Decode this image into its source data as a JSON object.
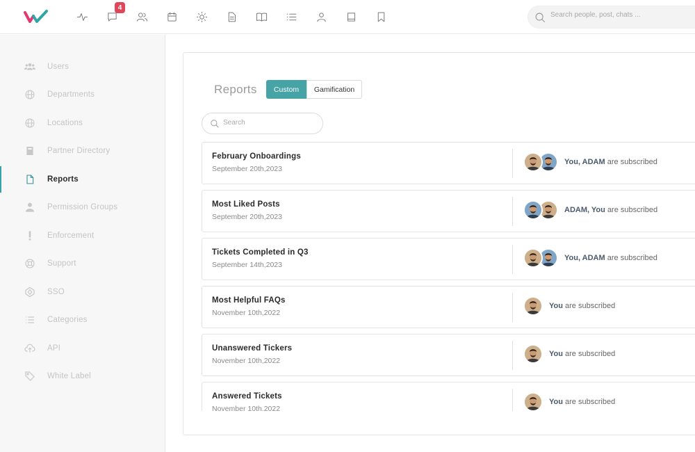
{
  "topbar": {
    "badge_count": "4",
    "search_placeholder": "Search people, post, chats ..."
  },
  "sidebar": {
    "items": [
      {
        "label": "Users",
        "icon": "users-icon"
      },
      {
        "label": "Departments",
        "icon": "globe-icon"
      },
      {
        "label": "Locations",
        "icon": "globe-icon"
      },
      {
        "label": "Partner Directory",
        "icon": "book-icon"
      },
      {
        "label": "Reports",
        "icon": "document-icon",
        "active": true
      },
      {
        "label": "Permission Groups",
        "icon": "person-icon"
      },
      {
        "label": "Enforcement",
        "icon": "exclamation-icon"
      },
      {
        "label": "Support",
        "icon": "lifebuoy-icon"
      },
      {
        "label": "SSO",
        "icon": "sso-icon"
      },
      {
        "label": "Categories",
        "icon": "list-icon"
      },
      {
        "label": "API",
        "icon": "cloud-upload-icon"
      },
      {
        "label": "White Label",
        "icon": "tag-icon"
      }
    ]
  },
  "main": {
    "title": "Reports",
    "tabs": [
      {
        "label": "Custom",
        "active": true
      },
      {
        "label": "Gamification",
        "active": false
      }
    ],
    "search_placeholder": "Search",
    "reports": [
      {
        "name": "February Onboardings",
        "date": "September 20th,2023",
        "subscribers": "You, ADAM",
        "suffix": "are subscribed",
        "avatars": [
          "you",
          "adam"
        ]
      },
      {
        "name": "Most Liked Posts",
        "date": "September 20th,2023",
        "subscribers": "ADAM, You",
        "suffix": "are subscribed",
        "avatars": [
          "adam",
          "you"
        ]
      },
      {
        "name": "Tickets Completed in Q3",
        "date": "September 14th,2023",
        "subscribers": "You, ADAM",
        "suffix": "are subscribed",
        "avatars": [
          "you",
          "adam"
        ]
      },
      {
        "name": "Most Helpful FAQs",
        "date": "November 10th,2022",
        "subscribers": "You",
        "suffix": "are subscribed",
        "avatars": [
          "you"
        ]
      },
      {
        "name": "Unanswered Tickers",
        "date": "November 10th,2022",
        "subscribers": "You",
        "suffix": "are subscribed",
        "avatars": [
          "you"
        ]
      },
      {
        "name": "Answered Tickets",
        "date": "November 10th,2022",
        "subscribers": "You",
        "suffix": "are subscribed",
        "avatars": [
          "you"
        ]
      }
    ]
  },
  "colors": {
    "accent": "#46a3a6",
    "badge": "#e0465a",
    "logo_pink": "#e0386f",
    "logo_teal": "#2fa5a5"
  }
}
